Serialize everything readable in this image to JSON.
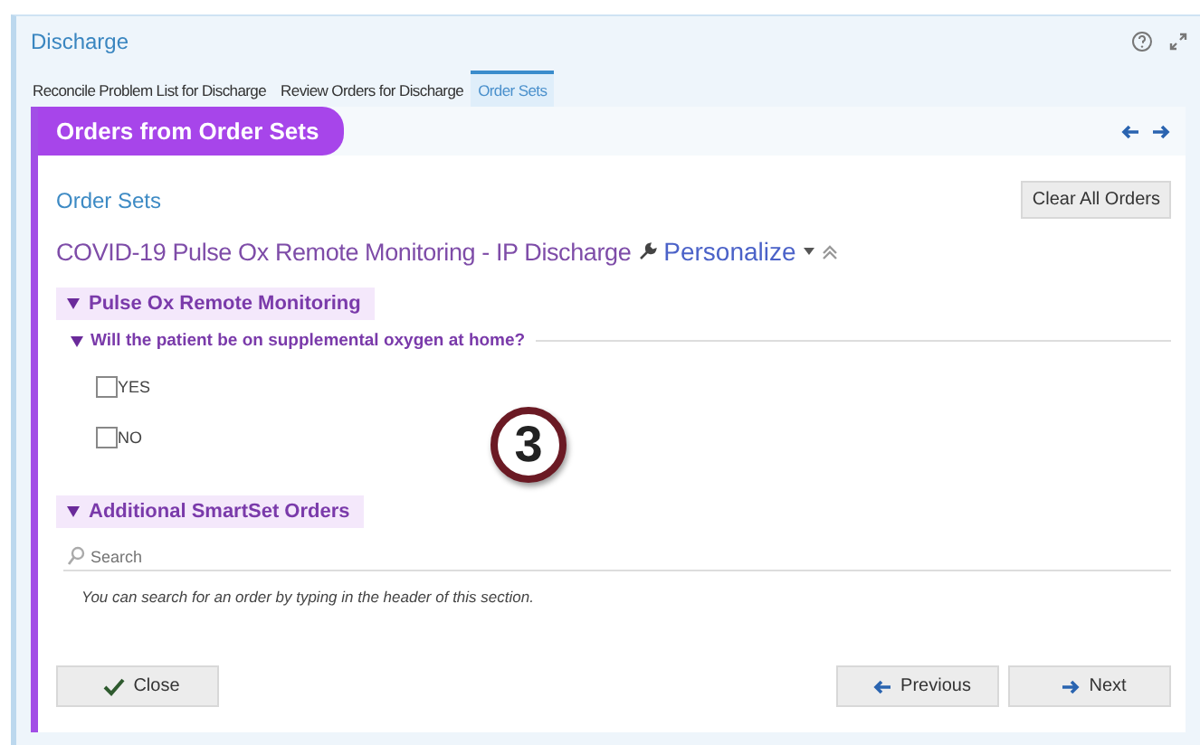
{
  "window": {
    "title": "Discharge"
  },
  "tabs": [
    {
      "label": "Reconcile Problem List for Discharge",
      "selected": false
    },
    {
      "label": "Review Orders for Discharge",
      "selected": false
    },
    {
      "label": "Order Sets",
      "selected": true
    }
  ],
  "panel": {
    "title": "Orders from Order Sets",
    "breadcrumb": "Order Sets",
    "clear_button": "Clear All Orders",
    "order_set_name": "COVID-19 Pulse Ox Remote Monitoring - IP Discharge",
    "personalize": "Personalize"
  },
  "sections": [
    {
      "title": "Pulse Ox Remote Monitoring",
      "expanded": true,
      "question": {
        "text": "Will the patient be on supplemental oxygen at home?",
        "expanded": true,
        "options": [
          {
            "label": "YES",
            "checked": false
          },
          {
            "label": "NO",
            "checked": false
          }
        ]
      }
    },
    {
      "title": "Additional SmartSet Orders",
      "expanded": true,
      "search": {
        "placeholder": "Search"
      },
      "hint": "You can search for an order by typing in the header of this section."
    }
  ],
  "step_badge": "3",
  "buttons": {
    "close": "Close",
    "previous": "Previous",
    "next": "Next"
  }
}
